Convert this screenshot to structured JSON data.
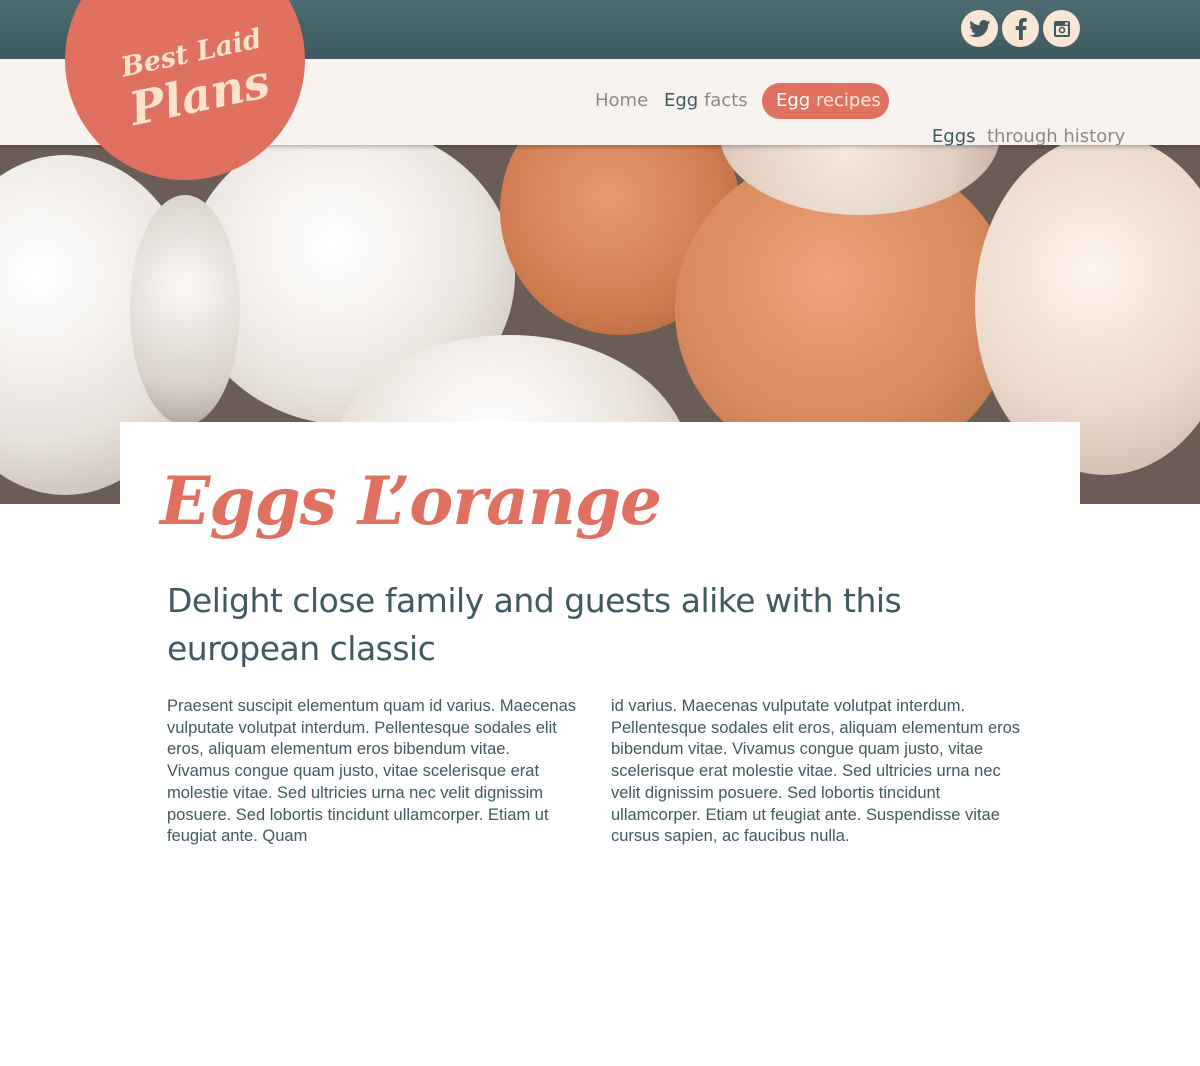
{
  "site": {
    "logo": {
      "line1": "Best Laid",
      "line2": "Plans"
    }
  },
  "social": [
    {
      "name": "twitter-icon"
    },
    {
      "name": "facebook-icon"
    },
    {
      "name": "instagram-icon"
    }
  ],
  "nav": {
    "home": "Home",
    "facts": {
      "strong": "Egg",
      "rest": " facts"
    },
    "recipes": {
      "strong": "Egg",
      "rest": " recipes"
    },
    "history": {
      "strong": "Eggs",
      "rest": "  through history"
    }
  },
  "article": {
    "title": "Eggs L’orange",
    "subtitle": "Delight close family and guests alike with this european classic",
    "column1": "Praesent suscipit elementum quam id varius. Maecenas vulputate volutpat interdum. Pellentesque sodales elit eros, aliquam elementum eros bibendum vitae. Vivamus congue quam justo, vitae scelerisque erat molestie vitae. Sed ultricies urna nec velit dignissim posuere. Sed lobortis tincidunt ullamcorper. Etiam ut feugiat ante. Quam",
    "column2": "id varius. Maecenas vulputate volutpat interdum. Pellentesque sodales elit eros, aliquam elementum eros bibendum vitae. Vivamus congue quam justo, vitae scelerisque erat molestie vitae. Sed ultricies urna nec velit dignissim posuere. Sed lobortis tincidunt ullamcorper. Etiam ut feugiat ante. Suspendisse vitae cursus sapien, ac faucibus nulla."
  },
  "colors": {
    "accent": "#e07060",
    "topbar": "#466168",
    "navbar": "#f8f3ef",
    "text": "#3f5a61",
    "logo_text": "#fce4cc"
  }
}
